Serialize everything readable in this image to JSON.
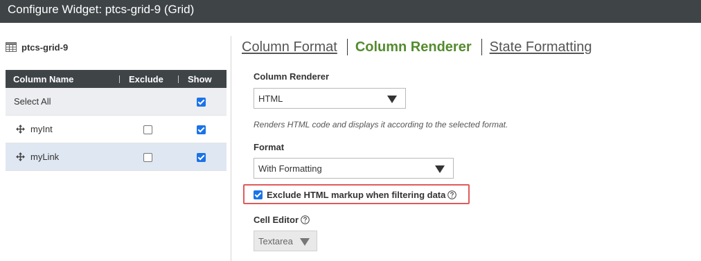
{
  "window": {
    "title": "Configure Widget: ptcs-grid-9 (Grid)"
  },
  "grid": {
    "name": "ptcs-grid-9",
    "icon": "table-icon",
    "headers": {
      "column_name": "Column Name",
      "exclude": "Exclude",
      "show": "Show"
    },
    "select_all": {
      "label": "Select All",
      "show": true
    },
    "rows": [
      {
        "name": "myInt",
        "exclude": false,
        "show": true
      },
      {
        "name": "myLink",
        "exclude": false,
        "show": true
      }
    ]
  },
  "tabs": [
    {
      "label": "Column Format",
      "active": false
    },
    {
      "label": "Column Renderer",
      "active": true
    },
    {
      "label": "State Formatting",
      "active": false
    }
  ],
  "renderer": {
    "column_renderer_label": "Column Renderer",
    "column_renderer_value": "HTML",
    "description": "Renders HTML code and displays it according to the selected format.",
    "format_label": "Format",
    "format_value": "With Formatting",
    "exclude_markup_label": "Exclude HTML markup when filtering data",
    "exclude_markup_checked": true,
    "cell_editor_label": "Cell Editor",
    "cell_editor_value": "Textarea"
  },
  "colors": {
    "titlebar": "#3f4447",
    "active_tab": "#558b2f",
    "checkbox": "#1a73e8",
    "highlight": "#e05a5a"
  }
}
